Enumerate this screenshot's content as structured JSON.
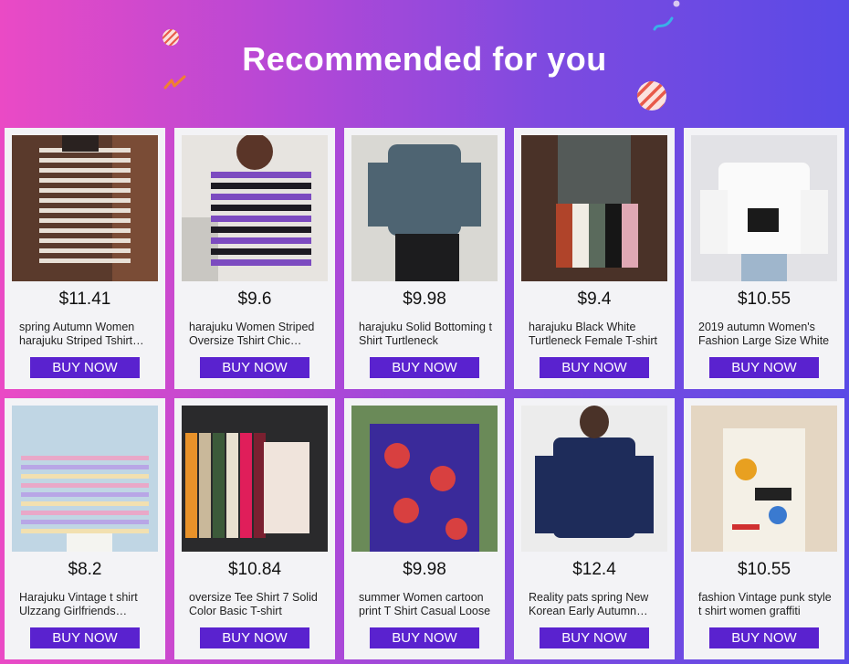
{
  "header": {
    "title": "Recommended for you"
  },
  "colors": {
    "button": "#5a22cf",
    "card_bg": "#f3f3f6"
  },
  "products": [
    {
      "price": "$11.41",
      "name": "spring Autumn Women harajuku Striped Tshirt Oversize",
      "image": "black-white-striped-shirt",
      "buy_label": "BUY NOW"
    },
    {
      "price": "$9.6",
      "name": "harajuku Women Striped Oversize Tshirt Chic Purple",
      "image": "purple-black-striped-shirt",
      "buy_label": "BUY NOW"
    },
    {
      "price": "$9.98",
      "name": "harajuku Solid Bottoming t Shirt Turtleneck",
      "image": "blue-gray-turtleneck",
      "buy_label": "BUY NOW"
    },
    {
      "price": "$9.4",
      "name": "harajuku Black White Turtleneck Female T-shirt",
      "image": "dark-turtleneck-colors",
      "buy_label": "BUY NOW"
    },
    {
      "price": "$10.55",
      "name": "2019 autumn Women's Fashion Large Size White",
      "image": "white-long-sleeve-shirt",
      "buy_label": "BUY NOW"
    },
    {
      "price": "$8.2",
      "name": "Harajuku Vintage t shirt Ulzzang Girlfriends Striped",
      "image": "pastel-striped-shirt",
      "buy_label": "BUY NOW"
    },
    {
      "price": "$10.84",
      "name": "oversize Tee Shirt 7 Solid Color Basic T-shirt",
      "image": "solid-color-tees",
      "buy_label": "BUY NOW"
    },
    {
      "price": "$9.98",
      "name": "summer Women cartoon print T Shirt Casual Loose",
      "image": "purple-print-tee",
      "buy_label": "BUY NOW"
    },
    {
      "price": "$12.4",
      "name": "Reality pats spring New Korean Early Autumn Navy",
      "image": "navy-long-sleeve-shirt",
      "buy_label": "BUY NOW"
    },
    {
      "price": "$10.55",
      "name": "fashion Vintage punk style t shirt women graffiti",
      "image": "graffiti-print-tee",
      "buy_label": "BUY NOW"
    }
  ]
}
